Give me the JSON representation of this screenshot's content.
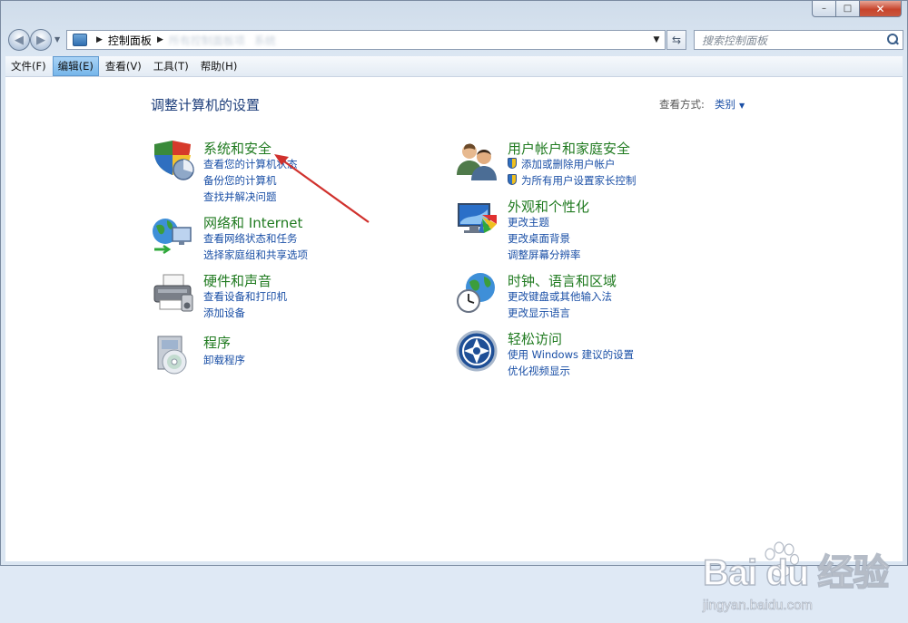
{
  "window": {
    "caption_buttons": {
      "minimize": "–",
      "maximize": "□",
      "close": "✕"
    }
  },
  "nav": {
    "back_glyph": "◀",
    "forward_glyph": "▶",
    "history_drop": "▼",
    "breadcrumb": [
      "控制面板"
    ],
    "breadcrumb_blurred": [
      "所有控制面板项",
      "系统"
    ],
    "sep_glyph": "▶",
    "drop_glyph": "▼",
    "refresh_glyph": "⇆",
    "search_placeholder": "搜索控制面板"
  },
  "menu": [
    {
      "label": "文件(F)",
      "active": false
    },
    {
      "label": "编辑(E)",
      "active": true
    },
    {
      "label": "查看(V)",
      "active": false
    },
    {
      "label": "工具(T)",
      "active": false
    },
    {
      "label": "帮助(H)",
      "active": false
    }
  ],
  "main": {
    "heading": "调整计算机的设置",
    "view_by_label": "查看方式:",
    "view_by_value": "类别",
    "view_by_drop": "▼"
  },
  "categories": [
    {
      "title": "系统和安全",
      "icon": "shield-icon",
      "links": [
        "查看您的计算机状态",
        "备份您的计算机",
        "查找并解决问题"
      ]
    },
    {
      "title": "网络和 Internet",
      "icon": "network-globe-icon",
      "links": [
        "查看网络状态和任务",
        "选择家庭组和共享选项"
      ]
    },
    {
      "title": "硬件和声音",
      "icon": "printer-icon",
      "links": [
        "查看设备和打印机",
        "添加设备"
      ]
    },
    {
      "title": "程序",
      "icon": "programs-disc-icon",
      "links": [
        "卸载程序"
      ]
    },
    {
      "title": "用户帐户和家庭安全",
      "icon": "users-icon",
      "links": [
        "添加或删除用户帐户",
        "为所有用户设置家长控制"
      ]
    },
    {
      "title": "外观和个性化",
      "icon": "monitor-palette-icon",
      "links": [
        "更改主题",
        "更改桌面背景",
        "调整屏幕分辨率"
      ]
    },
    {
      "title": "时钟、语言和区域",
      "icon": "clock-globe-icon",
      "links": [
        "更改键盘或其他输入法",
        "更改显示语言"
      ]
    },
    {
      "title": "轻松访问",
      "icon": "ease-of-access-icon",
      "links": [
        "使用 Windows 建议的设置",
        "优化视频显示"
      ]
    }
  ],
  "annotation": {
    "color": "#d0312d"
  },
  "watermark": {
    "brand": "Bai du 经验",
    "url": "jingyan.baidu.com"
  },
  "colors": {
    "title_green": "#1f7a1f",
    "link_blue": "#1a4fa6",
    "heading_blue": "#1c3d7a"
  }
}
